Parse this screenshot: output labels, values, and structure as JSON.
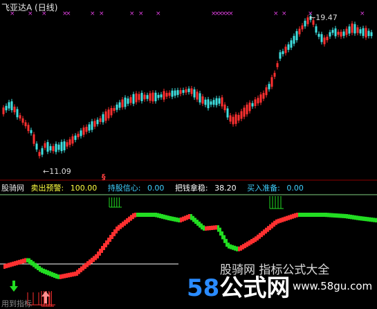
{
  "header": {
    "title": "飞亚达A",
    "period": "(日线)"
  },
  "price_labels": {
    "high": "19.47",
    "low": "11.09",
    "signal": "§"
  },
  "indicator": {
    "name": "股骑网",
    "sell_warning_label": "卖出预警:",
    "sell_warning_value": "100.00",
    "hold_conf_label": "持股信心:",
    "hold_conf_value": "0.00",
    "grip_label": "把钱拿稳:",
    "grip_value": "38.20",
    "buy_ready_label": "买入准备:",
    "buy_ready_value": "0.00"
  },
  "watermark": {
    "number": "58",
    "text": "公式网",
    "slogan": "股骑网 指标公式大全",
    "url": "www.58gu.com"
  },
  "footer": {
    "partial": "用到指标"
  },
  "colors": {
    "up": "#ff3030",
    "down": "#40e0e0",
    "green": "#22dd22",
    "magenta": "#e040e0",
    "cyan": "#40d0ff",
    "yellow": "#ffff40"
  },
  "icons": [
    "x-marker-icon",
    "down-arrow-icon",
    "up-arrow-icon"
  ]
}
